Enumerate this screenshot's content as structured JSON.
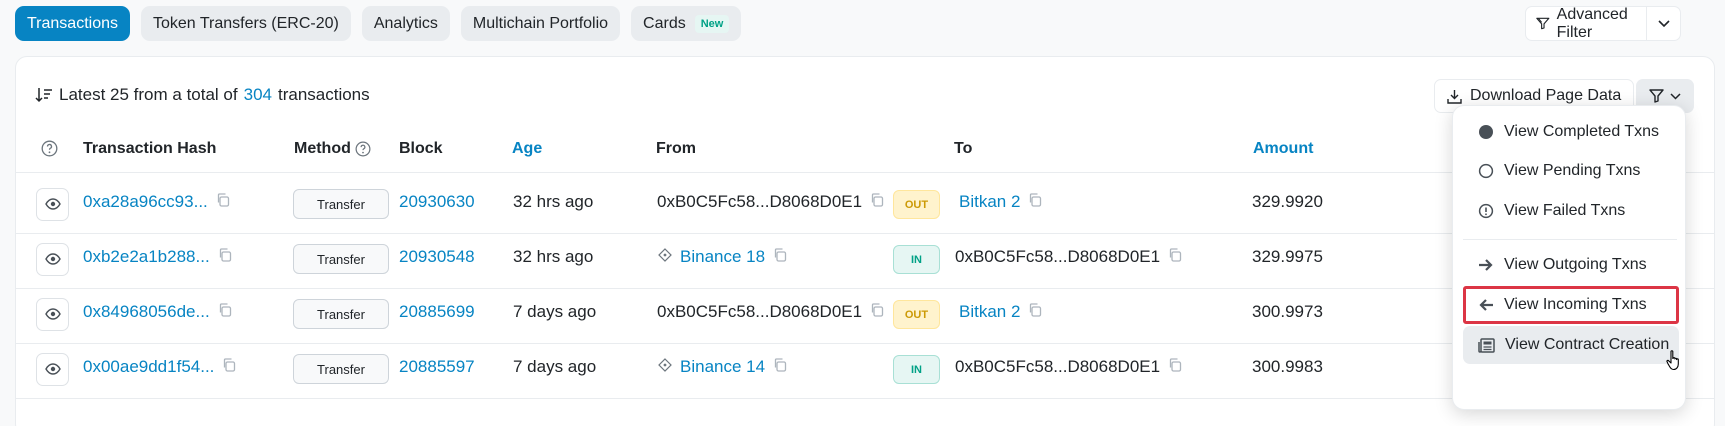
{
  "tabs": [
    {
      "label": "Transactions"
    },
    {
      "label": "Token Transfers (ERC-20)"
    },
    {
      "label": "Analytics"
    },
    {
      "label": "Multichain Portfolio"
    },
    {
      "label": "Cards",
      "badge": "New"
    }
  ],
  "advanced_filter": {
    "label": "Advanced Filter"
  },
  "summary": {
    "prefix": "Latest 25 from a total of",
    "count": "304",
    "suffix": "transactions"
  },
  "download_label": "Download Page Data",
  "columns": {
    "hash": "Transaction Hash",
    "method": "Method",
    "block": "Block",
    "age": "Age",
    "from": "From",
    "to": "To",
    "amount": "Amount"
  },
  "rows": [
    {
      "hash": "0xa28a96cc93...",
      "method": "Transfer",
      "block": "20930630",
      "age": "32 hrs ago",
      "from": "0xB0C5Fc58...D8068D0E1",
      "from_link": false,
      "dir": "OUT",
      "to": "Bitkan 2",
      "to_link": true,
      "amount": "329.9920"
    },
    {
      "hash": "0xb2e2a1b288...",
      "method": "Transfer",
      "block": "20930548",
      "age": "32 hrs ago",
      "from": "Binance 18",
      "from_link": true,
      "dir": "IN",
      "to": "0xB0C5Fc58...D8068D0E1",
      "to_link": false,
      "amount": "329.9975"
    },
    {
      "hash": "0x84968056de...",
      "method": "Transfer",
      "block": "20885699",
      "age": "7 days ago",
      "from": "0xB0C5Fc58...D8068D0E1",
      "from_link": false,
      "dir": "OUT",
      "to": "Bitkan 2",
      "to_link": true,
      "amount": "300.9973"
    },
    {
      "hash": "0x00ae9dd1f54...",
      "method": "Transfer",
      "block": "20885597",
      "age": "7 days ago",
      "from": "Binance 14",
      "from_link": true,
      "dir": "IN",
      "to": "0xB0C5Fc58...D8068D0E1",
      "to_link": false,
      "amount": "300.9983"
    }
  ],
  "filter_menu": {
    "items": [
      {
        "label": "View Completed Txns",
        "icon": "filled-circle-icon"
      },
      {
        "label": "View Pending Txns",
        "icon": "empty-circle-icon"
      },
      {
        "label": "View Failed Txns",
        "icon": "alert-circle-icon"
      },
      {
        "label": "View Outgoing Txns",
        "icon": "arrow-right-icon"
      },
      {
        "label": "View Incoming Txns",
        "icon": "arrow-left-icon"
      },
      {
        "label": "View Contract Creation",
        "icon": "newspaper-icon"
      }
    ]
  },
  "colors": {
    "accent": "#0784c3",
    "highlight_border": "#dc3545",
    "out": "#cc9a06",
    "in": "#00a186"
  }
}
